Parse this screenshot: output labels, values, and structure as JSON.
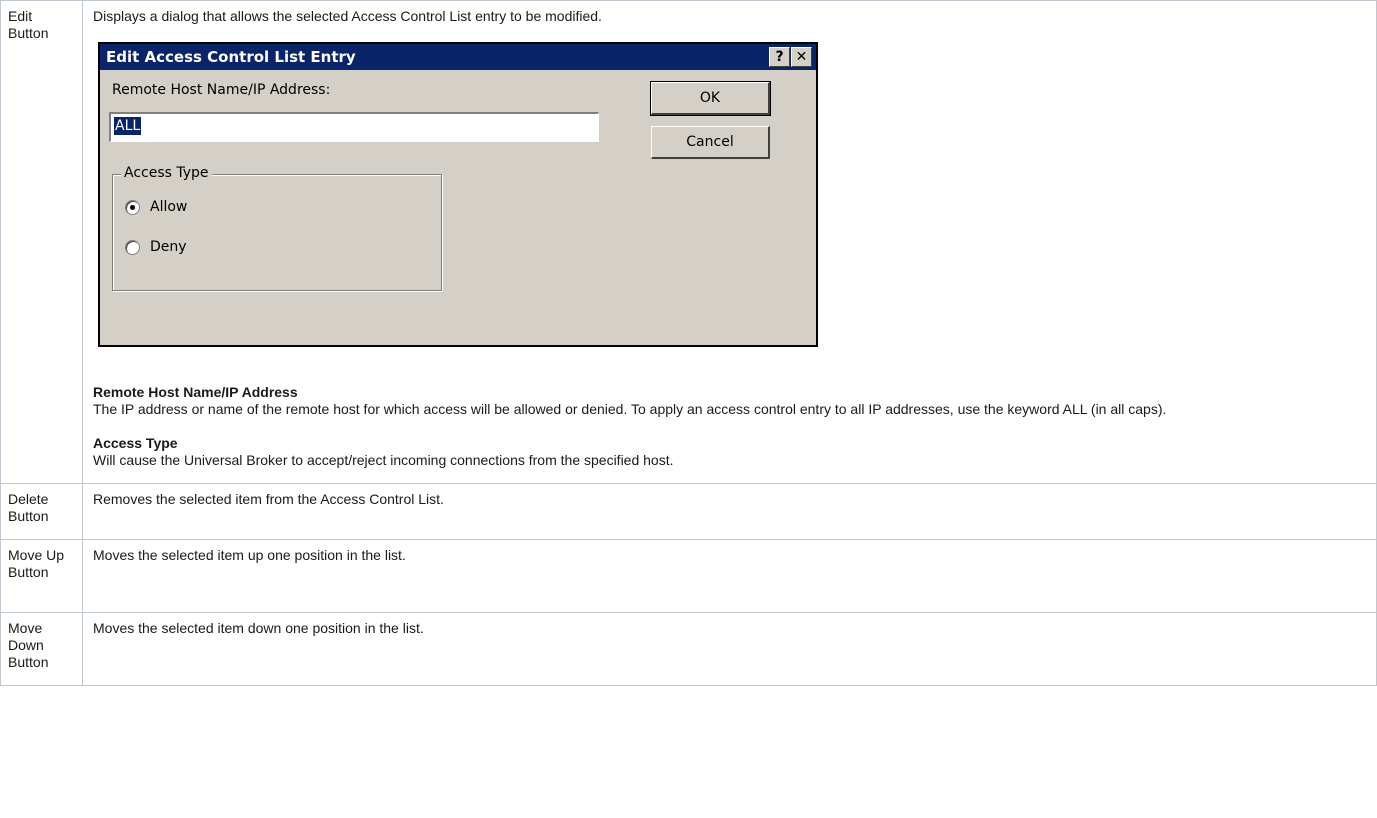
{
  "rows": [
    {
      "label": "Edit Button",
      "description": "Displays a dialog that allows the selected Access Control List entry to be modified."
    },
    {
      "label": "Delete Button",
      "description": "Removes the selected item from the Access Control List."
    },
    {
      "label": "Move Up Button",
      "description": "Moves the selected item up one position in the list."
    },
    {
      "label": "Move Down Button",
      "description": "Moves the selected item down one position in the list."
    }
  ],
  "dialog": {
    "title": "Edit Access Control List Entry",
    "help_glyph": "?",
    "close_glyph": "✕",
    "host_label": "Remote Host Name/IP Address:",
    "host_value": "ALL",
    "ok_label": "OK",
    "cancel_label": "Cancel",
    "group_title": "Access Type",
    "option_allow": "Allow",
    "option_deny": "Deny",
    "selected_option": "Allow"
  },
  "field_descriptions": [
    {
      "heading": "Remote Host Name/IP Address",
      "text": "The IP address or name of the remote host for which access will be allowed or denied. To apply an access control entry to all IP addresses, use the keyword ALL (in all caps)."
    },
    {
      "heading": "Access Type",
      "text": "Will cause the Universal Broker to accept/reject incoming connections from the specified host."
    }
  ],
  "colors": {
    "titlebar": "#0a246a",
    "dialog_face": "#d4d0c8",
    "table_border": "#c1c7d0"
  }
}
